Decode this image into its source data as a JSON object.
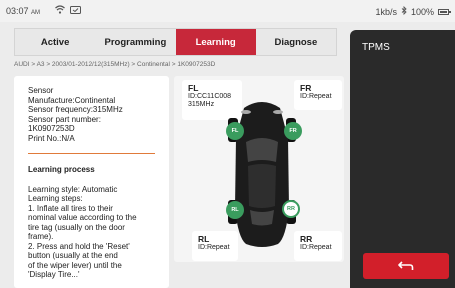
{
  "status_bar": {
    "time": "03:07",
    "ampm": "AM",
    "net_speed": "1kb/s",
    "battery": "100%",
    "icons": [
      "wifi-icon",
      "battery-saver-icon",
      "bluetooth-icon",
      "battery-icon"
    ]
  },
  "tabs": [
    {
      "label": "Active"
    },
    {
      "label": "Programming"
    },
    {
      "label": "Learning"
    },
    {
      "label": "Diagnose"
    }
  ],
  "active_tab": "Learning",
  "breadcrumb": "AUDI > A3 > 2003/01-2012/12(315MHz) > Continental > 1K0907253D",
  "sensor_info": {
    "title": "Sensor",
    "manufacturer": "Manufacture:Continental",
    "frequency": "Sensor frequency:315MHz",
    "part_label": "Sensor part number:",
    "part_number": "1K0907253D",
    "print_no": "Print No.:N/A"
  },
  "learning": {
    "title": "Learning process",
    "lines": [
      "Learning style: Automatic",
      "Learning steps:",
      "1. Inflate all tires to their",
      "nominal value according to the",
      "tire tag (usually on the door",
      "frame).",
      "2. Press and hold the 'Reset'",
      "button (usually at the end",
      "of the wiper lever) until the",
      "'Display Tire...'"
    ]
  },
  "tires": {
    "fl": {
      "pos": "FL",
      "line1": "ID:CC11C008",
      "line2": "315MHz",
      "dot": "FL"
    },
    "fr": {
      "pos": "FR",
      "line1": "ID:Repeat",
      "dot": "FR"
    },
    "rl": {
      "pos": "RL",
      "line1": "ID:Repeat",
      "dot": "RL"
    },
    "rr": {
      "pos": "RR",
      "line1": "ID:Repeat",
      "dot": "RR"
    }
  },
  "colors": {
    "accent_red": "#c7283a",
    "tire_green": "#3a9c5e",
    "divider_orange": "#e07a3a",
    "side_panel": "#2a2a2a"
  },
  "right_panel": {
    "title": "TPMS",
    "back_icon": "return-arrow-icon"
  }
}
